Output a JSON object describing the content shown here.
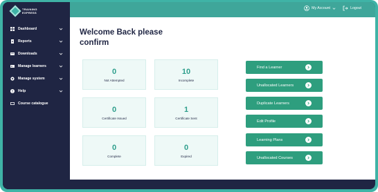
{
  "brand": {
    "line1": "TRAINING",
    "line2": "EXPRESS"
  },
  "sidebar": {
    "items": [
      {
        "label": "Dashboard",
        "icon": "grid-icon",
        "chevron": true
      },
      {
        "label": "Reports",
        "icon": "report-icon",
        "chevron": true
      },
      {
        "label": "Downloads",
        "icon": "download-icon",
        "chevron": true
      },
      {
        "label": "Manage learners",
        "icon": "users-icon",
        "chevron": true
      },
      {
        "label": "Manage system",
        "icon": "gear-icon",
        "chevron": true
      },
      {
        "label": "Help",
        "icon": "help-icon",
        "chevron": true
      },
      {
        "label": "Course catalogue",
        "icon": "catalogue-icon",
        "chevron": false
      }
    ]
  },
  "topbar": {
    "account_label": "My Account",
    "logout_label": "Logout"
  },
  "main": {
    "welcome": "Welcome Back please confirm"
  },
  "stats": [
    {
      "value": "0",
      "label": "Not Attempted"
    },
    {
      "value": "10",
      "label": "Incomplete"
    },
    {
      "value": "0",
      "label": "Certificate Issued"
    },
    {
      "value": "1",
      "label": "Certificate Sent"
    },
    {
      "value": "0",
      "label": "Complete"
    },
    {
      "value": "0",
      "label": "Expired"
    }
  ],
  "actions": [
    {
      "label": "Find a Learner"
    },
    {
      "label": "Unallocated Learners"
    },
    {
      "label": "Duplicate Learners"
    },
    {
      "label": "Edit Profile"
    },
    {
      "label": "Learning Plans"
    },
    {
      "label": "Unallocated Courses"
    }
  ],
  "colors": {
    "brand_teal": "#3fa69a",
    "sidebar_bg": "#1f2543",
    "button_green": "#2e9e7e",
    "stat_bg": "#eef9f7"
  }
}
